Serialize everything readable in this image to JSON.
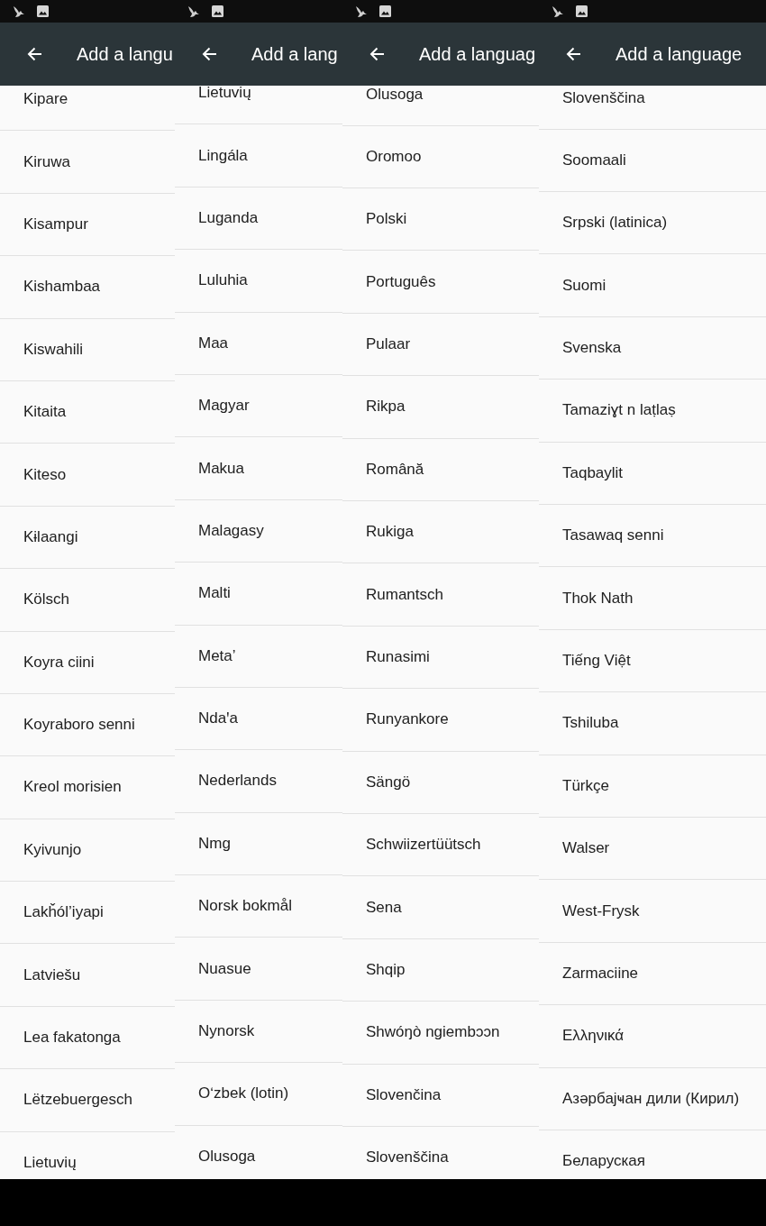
{
  "panels": [
    {
      "title": "Add a langu",
      "languages": [
        "Kipare",
        "Kiruwa",
        "Kisampur",
        "Kishambaa",
        "Kiswahili",
        "Kitaita",
        "Kiteso",
        "Kɨlaangi",
        "Kölsch",
        "Koyra ciini",
        "Koyraboro senni",
        "Kreol morisien",
        "Kyivunjo",
        "Lakȟól’iyapi",
        "Latviešu",
        "Lea fakatonga",
        "Lëtzebuergesch",
        "Lietuvių"
      ]
    },
    {
      "title": "Add a lang",
      "languages": [
        "Lietuvių",
        "Lingála",
        "Luganda",
        "Luluhia",
        "Maa",
        "Magyar",
        "Makua",
        "Malagasy",
        "Malti",
        "Meta’",
        "Ndaꞌa",
        "Nederlands",
        "Nmg",
        "Norsk bokmål",
        "Nuasue",
        "Nynorsk",
        "Oʻzbek (lotin)",
        "Olusoga"
      ]
    },
    {
      "title": "Add a languag",
      "languages": [
        "Olusoga",
        "Oromoo",
        "Polski",
        "Português",
        "Pulaar",
        "Rikpa",
        "Română",
        "Rukiga",
        "Rumantsch",
        "Runasimi",
        "Runyankore",
        "Sängö",
        "Schwiizertüütsch",
        "Sena",
        "Shqip",
        "Shwóŋò ngiembɔɔn",
        "Slovenčina",
        "Slovenščina"
      ]
    },
    {
      "title": "Add a language",
      "languages": [
        "Slovenščina",
        "Soomaali",
        "Srpski (latinica)",
        "Suomi",
        "Svenska",
        "Tamaziɣt n laṭlaṣ",
        "Taqbaylit",
        "Tasawaq senni",
        "Thok Nath",
        "Tiếng Việt",
        "Tshiluba",
        "Türkçe",
        "Walser",
        "West-Frysk",
        "Zarmaciine",
        "Ελληνικά",
        "Азәрбајҹан дили (Кирил)",
        "Беларуская"
      ]
    }
  ]
}
